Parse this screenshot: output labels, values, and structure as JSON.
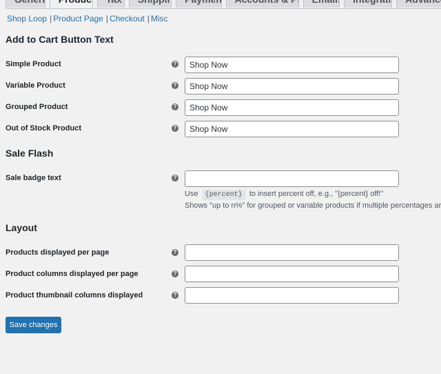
{
  "tabs": [
    "General",
    "Products",
    "Tax",
    "Shipping",
    "Payments",
    "Accounts & Privacy",
    "Emails",
    "Integration",
    "Advanced"
  ],
  "subnav": [
    "Shop Loop",
    "Product Page",
    "Checkout",
    "Misc"
  ],
  "subnav_separator": "|",
  "help_glyph": "?",
  "sections": {
    "add_to_cart": {
      "title": "Add to Cart Button Text",
      "rows": [
        {
          "label": "Simple Product",
          "value": "Shop Now"
        },
        {
          "label": "Variable Product",
          "value": "Shop Now"
        },
        {
          "label": "Grouped Product",
          "value": "Shop Now"
        },
        {
          "label": "Out of Stock Product",
          "value": "Shop Now"
        }
      ]
    },
    "sale_flash": {
      "title": "Sale Flash",
      "rows": [
        {
          "label": "Sale badge text",
          "value": ""
        }
      ],
      "desc_pre": "Use",
      "desc_code": "{percent}",
      "desc_post": "to insert percent off, e.g., \"{percent} off!\"",
      "desc_line2": "Shows \"up to n%\" for grouped or variable products if multiple percentages are"
    },
    "layout": {
      "title": "Layout",
      "rows": [
        {
          "label": "Products displayed per page",
          "value": ""
        },
        {
          "label": "Product columns displayed per page",
          "value": ""
        },
        {
          "label": "Product thumbnail columns displayed",
          "value": ""
        }
      ]
    }
  },
  "save_label": "Save changes",
  "colors": {
    "accent": "#2271b1",
    "background": "#f1f1f1",
    "help_icon": "#646970"
  }
}
